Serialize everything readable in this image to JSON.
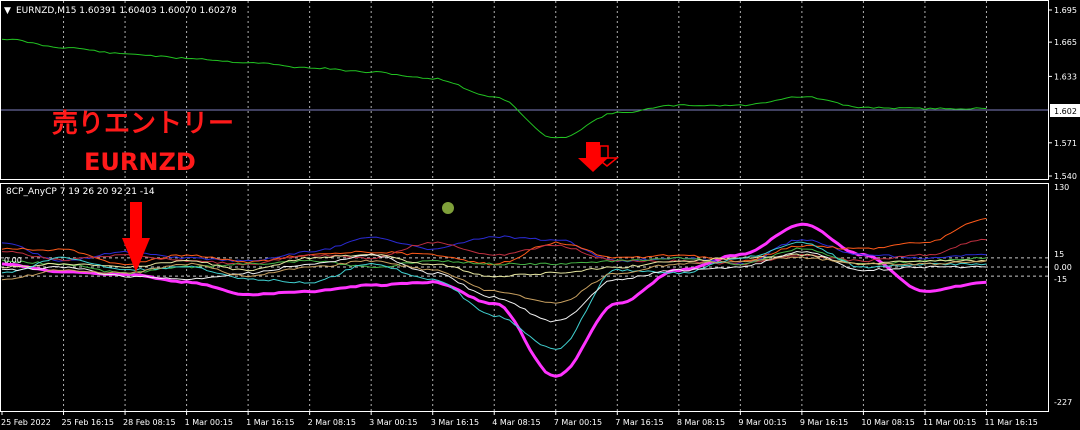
{
  "price_panel": {
    "symbol_header": "EURNZD,M15  1.60391 1.60403 1.60070 1.60278",
    "price_labels": [
      "1.695",
      "1.665",
      "1.633",
      "1.602",
      "1.571",
      "1.540"
    ],
    "current_price": "1.602",
    "colors": {
      "price_line": "#22c322",
      "current_line": "#8080c0",
      "box": "#ffffff"
    }
  },
  "annotations": {
    "entry_title": "売りエントリー",
    "entry_symbol": "EURNZD",
    "arrow_color": "#ff0000",
    "dot_color": "#7fa03a"
  },
  "indicator_panel": {
    "header": "8CP_AnyCP 7 19 26 20 92 21 -14",
    "left_level_label": "0.00",
    "scale_labels": [
      "130",
      "15",
      "0.00",
      "-15",
      "-227"
    ]
  },
  "time_axis": {
    "labels": [
      "25 Feb 2022",
      "25 Feb 16:15",
      "28 Feb 08:15",
      "1 Mar 00:15",
      "1 Mar 16:15",
      "2 Mar 08:15",
      "3 Mar 00:15",
      "3 Mar 16:15",
      "4 Mar 08:15",
      "7 Mar 00:15",
      "7 Mar 16:15",
      "8 Mar 08:15",
      "9 Mar 00:15",
      "9 Mar 16:15",
      "10 Mar 08:15",
      "11 Mar 00:15",
      "11 Mar 16:15"
    ]
  },
  "chart_data": {
    "type": "line",
    "title": "EURNZD,M15",
    "price_axis_range": [
      1.54,
      1.695
    ],
    "indicator_axis_range": [
      -227,
      130
    ],
    "indicator_levels": [
      15,
      0,
      -15
    ],
    "x": [
      "25 Feb 2022",
      "25 Feb 16:15",
      "28 Feb 08:15",
      "1 Mar 00:15",
      "1 Mar 16:15",
      "2 Mar 08:15",
      "3 Mar 00:15",
      "3 Mar 16:15",
      "4 Mar 08:15",
      "7 Mar 00:15",
      "7 Mar 16:15",
      "8 Mar 08:15",
      "9 Mar 00:15",
      "9 Mar 16:15",
      "10 Mar 08:15",
      "11 Mar 00:15",
      "11 Mar 16:15"
    ],
    "series": [
      {
        "color": "#22c322",
        "panel": "price",
        "values": [
          1.668,
          1.66,
          1.654,
          1.65,
          1.646,
          1.641,
          1.637,
          1.631,
          1.614,
          1.575,
          1.599,
          1.606,
          1.606,
          1.614,
          1.604,
          1.603,
          1.603
        ]
      },
      {
        "color": "#ff33ff",
        "panel": "indicator",
        "values": [
          5,
          -8,
          -12,
          -25,
          -45,
          -40,
          -30,
          -25,
          -60,
          -180,
          -60,
          -5,
          20,
          70,
          20,
          -40,
          -25
        ]
      },
      {
        "color": "#2b2bd6",
        "panel": "indicator",
        "values": [
          38,
          10,
          25,
          15,
          10,
          25,
          48,
          30,
          50,
          45,
          10,
          15,
          5,
          45,
          20,
          15,
          20
        ]
      },
      {
        "color": "#ff5a1a",
        "panel": "indicator",
        "values": [
          30,
          28,
          5,
          20,
          8,
          20,
          25,
          20,
          5,
          40,
          15,
          20,
          10,
          35,
          30,
          40,
          80
        ]
      },
      {
        "color": "#c03040",
        "panel": "indicator",
        "values": [
          25,
          12,
          20,
          10,
          5,
          20,
          15,
          40,
          20,
          35,
          10,
          10,
          5,
          20,
          10,
          20,
          45
        ]
      },
      {
        "color": "#46b446",
        "panel": "indicator",
        "values": [
          10,
          5,
          -10,
          0,
          5,
          10,
          0,
          10,
          5,
          5,
          10,
          15,
          5,
          30,
          5,
          10,
          15
        ]
      },
      {
        "color": "#e6e6a0",
        "panel": "indicator",
        "values": [
          0,
          5,
          0,
          10,
          -5,
          15,
          20,
          5,
          -15,
          -10,
          0,
          10,
          15,
          20,
          5,
          10,
          10
        ]
      },
      {
        "color": "#40d0d0",
        "panel": "indicator",
        "values": [
          -10,
          15,
          -5,
          0,
          -20,
          -25,
          5,
          -20,
          -80,
          -135,
          -5,
          -10,
          15,
          40,
          0,
          5,
          5
        ]
      },
      {
        "color": "#f0f0f0",
        "panel": "indicator",
        "values": [
          -5,
          0,
          -15,
          -20,
          -10,
          5,
          20,
          -10,
          -50,
          -90,
          -20,
          -5,
          0,
          25,
          -5,
          0,
          0
        ]
      },
      {
        "color": "#c8a060",
        "panel": "indicator",
        "values": [
          -20,
          -5,
          -10,
          5,
          -15,
          0,
          10,
          -5,
          -40,
          -60,
          -10,
          5,
          10,
          15,
          5,
          5,
          10
        ]
      }
    ]
  }
}
